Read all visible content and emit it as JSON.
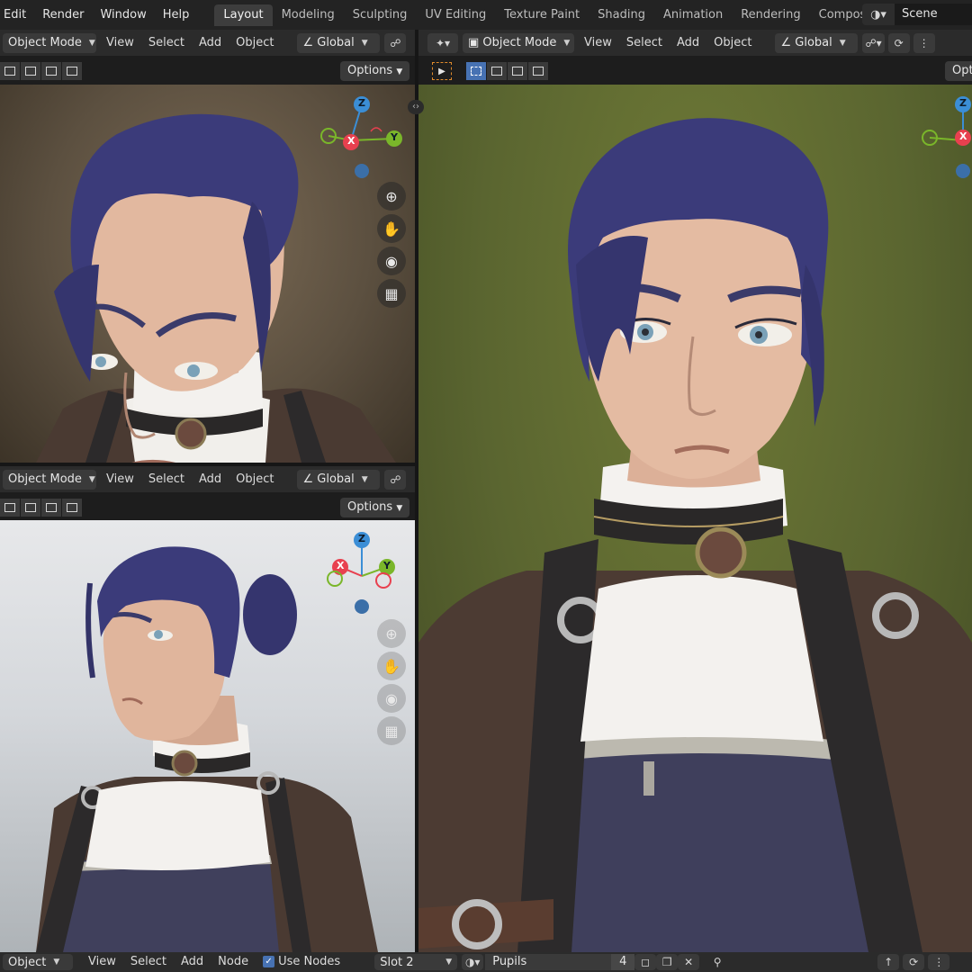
{
  "topbar": {
    "menus": [
      "Edit",
      "Render",
      "Window",
      "Help"
    ],
    "tabs": [
      "Layout",
      "Modeling",
      "Sculpting",
      "UV Editing",
      "Texture Paint",
      "Shading",
      "Animation",
      "Rendering",
      "Compositin"
    ],
    "active_tab": "Layout",
    "scene_label": "Scene"
  },
  "viewport_header": {
    "mode": "Object Mode",
    "view": "View",
    "select": "Select",
    "add": "Add",
    "object": "Object",
    "orientation": "Global"
  },
  "options_label": "Options",
  "options_label_cut": "Opt",
  "gizmo": {
    "x": "X",
    "y": "Y",
    "z": "Z"
  },
  "colors": {
    "accent": "#4772b3",
    "axis_x": "#e8404f",
    "axis_y": "#7ab62a",
    "axis_z": "#3b8ed6",
    "hair": "#3b3b7a",
    "skin": "#e2b89f"
  },
  "nav_icons": [
    "zoom-icon",
    "pan-hand-icon",
    "camera-icon",
    "grid-perspective-icon"
  ],
  "bottombar": {
    "object": "Object",
    "view": "View",
    "select": "Select",
    "add": "Add",
    "node": "Node",
    "use_nodes": "Use Nodes",
    "slot": "Slot 2",
    "material": "Pupils",
    "users": "4"
  }
}
